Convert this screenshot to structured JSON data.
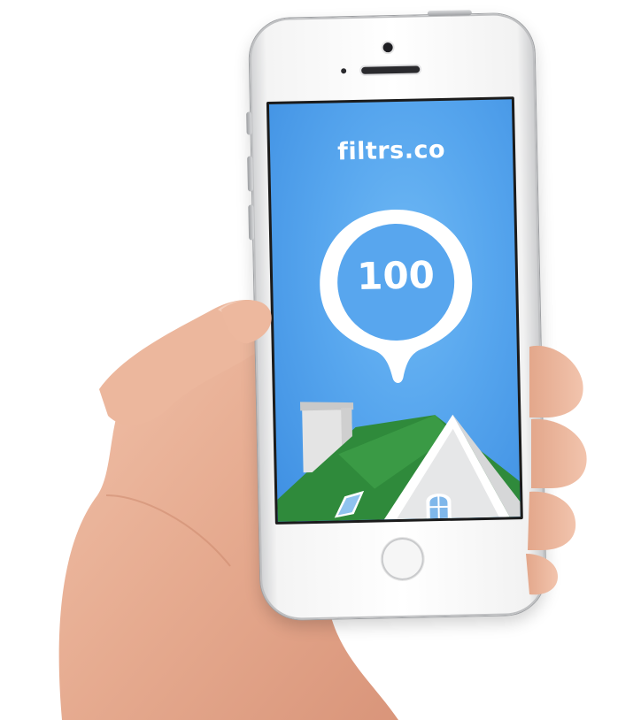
{
  "app": {
    "brand": "filtrs.co",
    "score": "100"
  },
  "icons": {
    "pin": "map-pin-icon",
    "house": "house-roof-illustration"
  },
  "colors": {
    "screen_blue": "#57a6ee",
    "pin_fill": "#ffffff",
    "roof_green": "#2f8a3b",
    "skin": "#e9b39a"
  }
}
